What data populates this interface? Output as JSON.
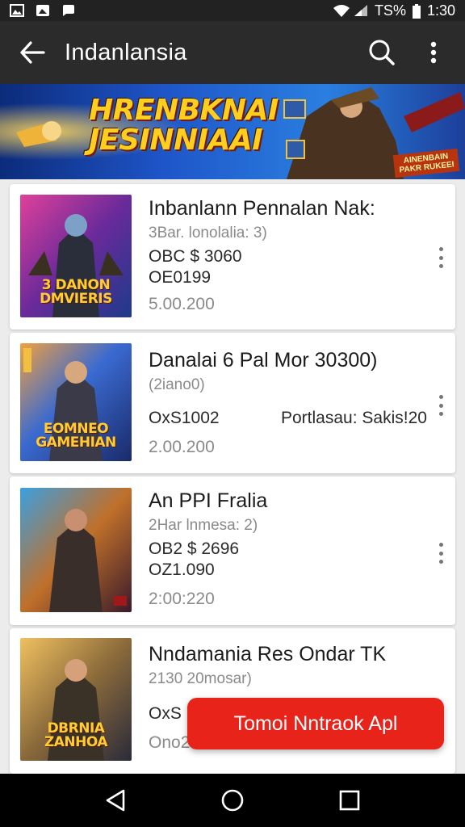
{
  "status_bar": {
    "battery": "ΤS%",
    "time": "1:30",
    "icons": [
      "gallery-icon",
      "image-icon",
      "chat-icon",
      "wifi-icon",
      "signal-icon",
      "battery-icon"
    ]
  },
  "app_bar": {
    "title": "Indanlansia",
    "icons": [
      "back-arrow-icon",
      "search-icon",
      "more-vert-icon"
    ]
  },
  "banner": {
    "headline_line1": "HRENBKNAI",
    "headline_line2": "JESINNIAAI",
    "badge_line1": "AINENBAIN",
    "badge_line2": "PAKR RUKEEI"
  },
  "items": [
    {
      "thumb_caption": "3 DANON DMVIERIS",
      "title": "Inbanlann Pennalan Nak:",
      "sub": "3Bar. lonolalia: 3)",
      "line1": "OBC $ 3060",
      "line2": "OE0199",
      "date": "5.00.200"
    },
    {
      "thumb_caption": "EOMNEO GAMEHIAN",
      "title": "Danalai 6 Pal Mor 30300)",
      "sub": "(2iano0)",
      "line1": "OxS1002",
      "extra": "Portlasau: Sakis!20",
      "date": "2.00.200"
    },
    {
      "thumb_caption": "",
      "title": "An PPI Fralia",
      "sub": "2Har lnmesa: 2)",
      "line1": "OB2 $ 2696",
      "line2": "OZ1.090",
      "date": "2:00:220"
    },
    {
      "thumb_caption": "DBRNIA ZANHOA",
      "title": "Nndamania Res Ondar TK",
      "sub": "2130 20mosar)",
      "line1": "OxS",
      "date": "Ono2"
    }
  ],
  "cta": {
    "label": "Tomoi Nntraok Apl"
  },
  "nav_bar": {
    "icons": [
      "back-triangle-icon",
      "home-circle-icon",
      "recents-square-icon"
    ]
  },
  "colors": {
    "accent": "#e8231a",
    "app_bar": "#2b2b2b",
    "banner_text": "#ffcf1f"
  }
}
